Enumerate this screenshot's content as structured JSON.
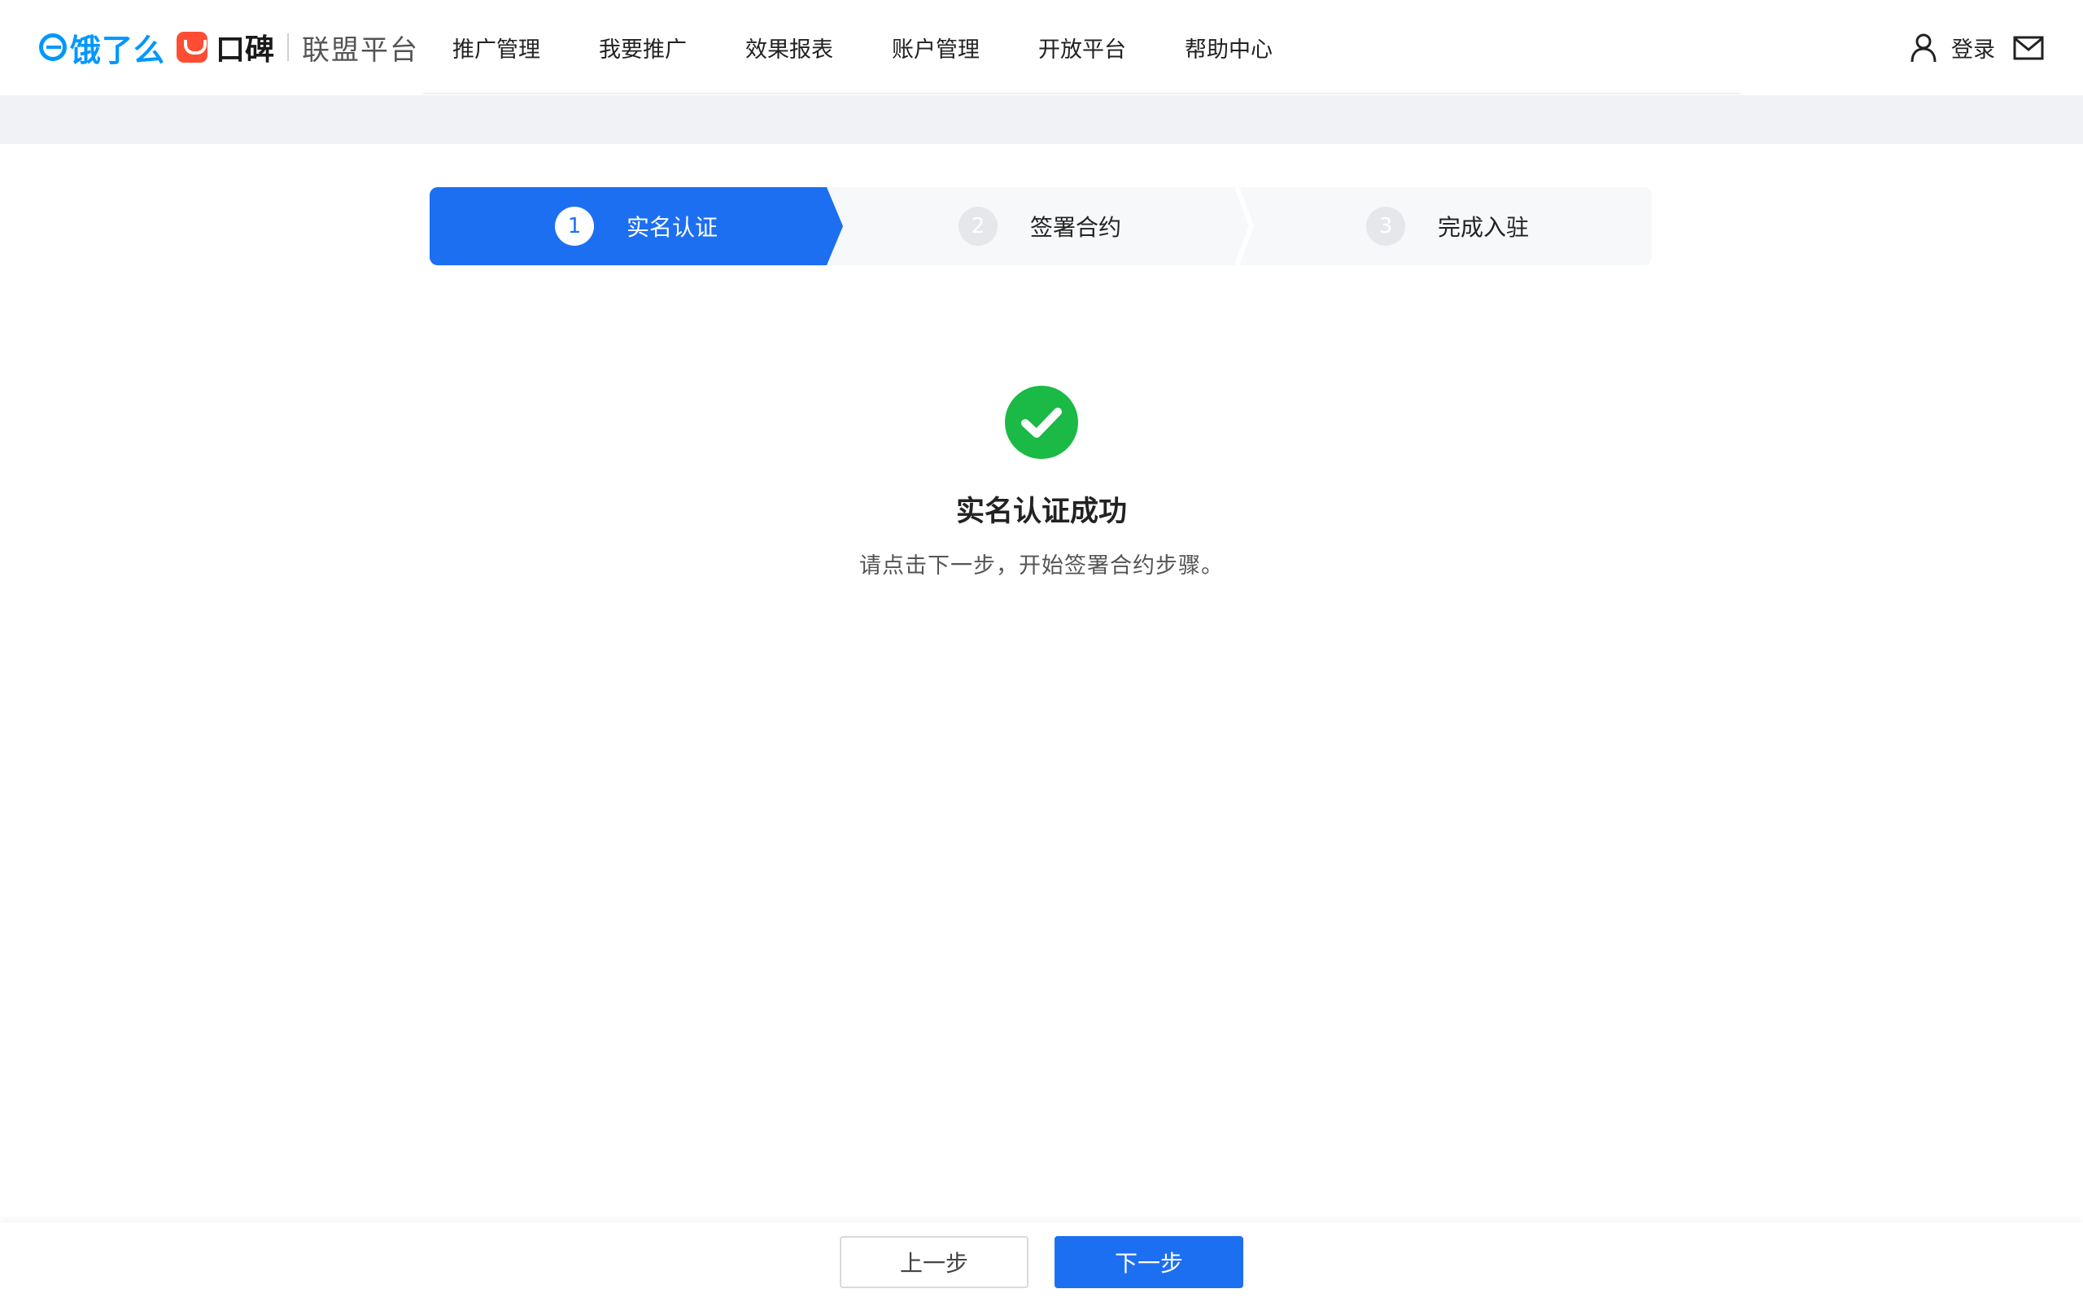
{
  "header": {
    "logo_eleme": "饿了么",
    "logo_koubei": "口碑",
    "logo_platform": "联盟平台",
    "nav": [
      "推广管理",
      "我要推广",
      "效果报表",
      "账户管理",
      "开放平台",
      "帮助中心"
    ],
    "login_label": "登录",
    "brand_color": "#0097ff",
    "koubei_color": "#ff4d33"
  },
  "steps": [
    {
      "number": "1",
      "label": "实名认证",
      "state": "active"
    },
    {
      "number": "2",
      "label": "签署合约",
      "state": "pending"
    },
    {
      "number": "3",
      "label": "完成入驻",
      "state": "pending"
    }
  ],
  "result": {
    "icon": "check-circle-icon",
    "icon_color": "#1bb945",
    "title": "实名认证成功",
    "description": "请点击下一步，开始签署合约步骤。"
  },
  "footer": {
    "prev_label": "上一步",
    "next_label": "下一步"
  },
  "colors": {
    "primary": "#1d6ff2",
    "success": "#1bb945"
  }
}
